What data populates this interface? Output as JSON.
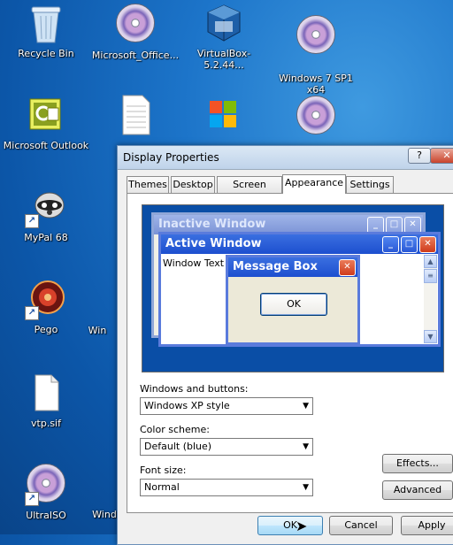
{
  "desktop": {
    "icons": [
      {
        "label": "Recycle Bin"
      },
      {
        "label": "Microsoft_Office..."
      },
      {
        "label": "VirtualBox-5.2.44..."
      },
      {
        "label": "Windows 7 SP1\nx64"
      },
      {
        "label": "Microsoft Outlook"
      },
      {
        "label": "MyPal 68"
      },
      {
        "label": "Pego"
      },
      {
        "label": "vtp.sif"
      },
      {
        "label": "UltraISO"
      }
    ],
    "partial_labels": [
      "Win",
      "Wind"
    ]
  },
  "dialog": {
    "title": "Display Properties",
    "help_glyph": "?",
    "close_glyph": "✕",
    "tabs": [
      {
        "label": "Themes"
      },
      {
        "label": "Desktop"
      },
      {
        "label": "Screen Saver"
      },
      {
        "label": "Appearance"
      },
      {
        "label": "Settings"
      }
    ],
    "preview": {
      "inactive_title": "Inactive Window",
      "active_title": "Active Window",
      "window_text": "Window Text",
      "message_title": "Message Box",
      "message_ok": "OK"
    },
    "windows_buttons_label": "Windows and buttons:",
    "windows_buttons_value": "Windows XP style",
    "color_scheme_label": "Color scheme:",
    "color_scheme_value": "Default (blue)",
    "font_size_label": "Font size:",
    "font_size_value": "Normal",
    "effects_label": "Effects...",
    "advanced_label": "Advanced",
    "ok_label": "OK",
    "cancel_label": "Cancel",
    "apply_label": "Apply"
  }
}
